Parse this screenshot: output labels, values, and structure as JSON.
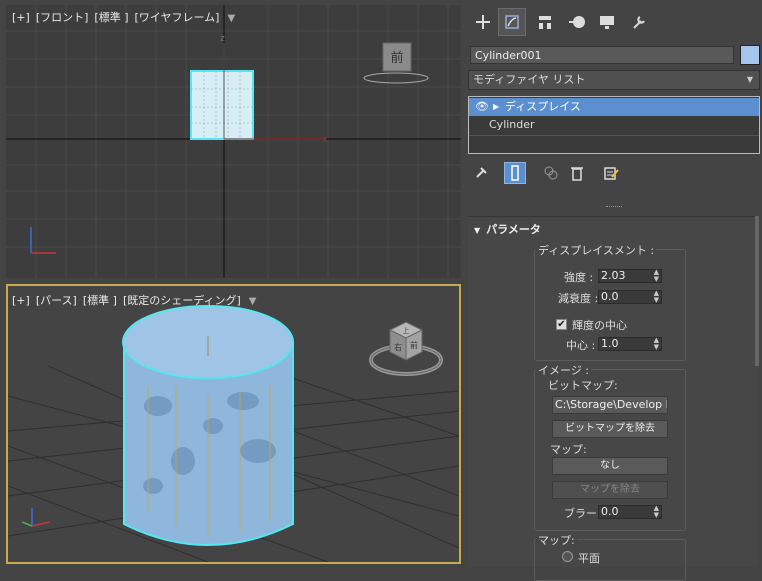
{
  "viewports": {
    "front": {
      "labels": [
        "[+]",
        "[フロント]",
        "[標準 ]",
        "[ワイヤフレーム]"
      ],
      "viewcube_label": "前",
      "axis_z": "z",
      "axis_x": "x"
    },
    "perspective": {
      "labels": [
        "[+]",
        "[パース]",
        "[標準 ]",
        "[既定のシェーディング]"
      ],
      "viewcube_top": "上",
      "viewcube_front": "前",
      "viewcube_right": "右"
    }
  },
  "panel": {
    "object_name": "Cylinder001",
    "object_color": "#a4c6ec",
    "modifier_list": "モディファイヤ リスト",
    "stack": [
      {
        "label": "ディスプレイス",
        "selected": true
      },
      {
        "label": "Cylinder",
        "selected": false
      }
    ],
    "rollout": {
      "title": "パラメータ",
      "displacement_group": "ディスプレイスメント :",
      "strength_label": "強度 :",
      "strength_value": "2.03",
      "decay_label": "減衰度 :",
      "decay_value": "0.0",
      "luminance_center_label": "輝度の中心",
      "center_label": "中心 :",
      "center_value": "1.0",
      "image_group": "イメージ :",
      "bitmap_label": "ビットマップ:",
      "bitmap_path": "C:\\Storage\\Develop Rep",
      "remove_bitmap_button": "ビットマップを除去",
      "map_label": "マップ:",
      "map_button": "なし",
      "remove_map_button": "マップを除去",
      "blur_label": "ブラー :",
      "blur_value": "0.0",
      "map2_group": "マップ:",
      "planar_label": "平面"
    }
  },
  "colors": {
    "selection": "#5b8fd0",
    "cylinder": "#9fc4e6",
    "highlight": "#55e6f0",
    "active_border": "#c8a950"
  }
}
